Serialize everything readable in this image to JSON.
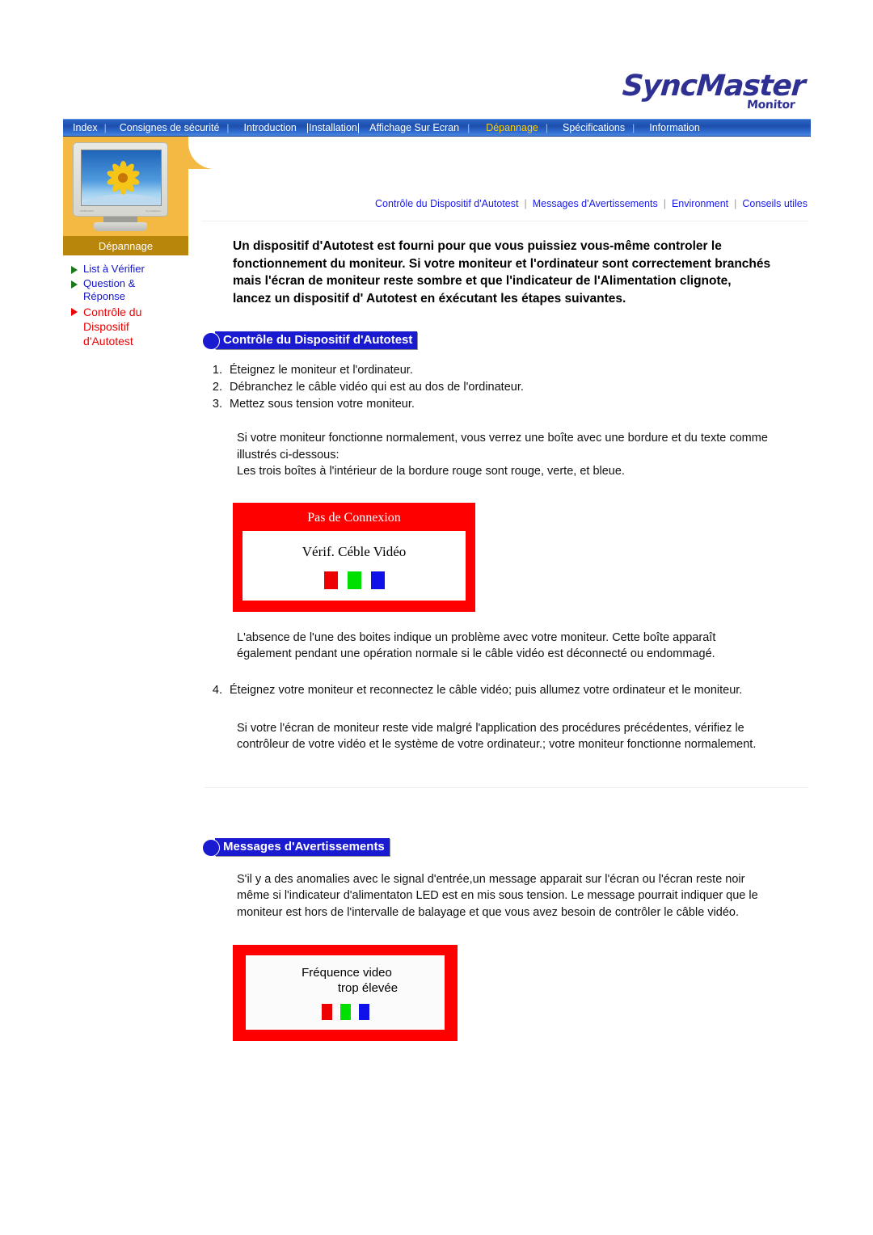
{
  "logo": {
    "main": "SyncMaster",
    "sub": "Monitor"
  },
  "nav": {
    "items": [
      {
        "label": "Index",
        "active": false
      },
      {
        "label": "Consignes de sécurité",
        "active": false
      },
      {
        "label": "Introduction",
        "active": false
      },
      {
        "label": "|Installation|",
        "active": false
      },
      {
        "label": "Affichage Sur Ecran",
        "active": false
      },
      {
        "label": "Dépannage",
        "active": true
      },
      {
        "label": "Spécifications",
        "active": false
      },
      {
        "label": "Information",
        "active": false
      }
    ],
    "separator": "|",
    "active_color": "#ffcc00",
    "bar_color": "#1e4fae"
  },
  "sidebar": {
    "title": "Dépannage",
    "thumbnail_icon": "monitor-flower-icon",
    "accent_color": "#f4b942",
    "title_bar_color": "#b8860b",
    "items": [
      {
        "label": "List à Vérifier",
        "active": false,
        "bullet": "triangle-right-icon"
      },
      {
        "label": "Question & Réponse",
        "active": false,
        "bullet": "triangle-right-icon"
      },
      {
        "label": "Contrôle du Dispositif d'Autotest",
        "active": true,
        "bullet": "triangle-right-icon"
      }
    ],
    "link_color": "#1414cc",
    "active_link_color": "#ee0000"
  },
  "sublinks": {
    "items": [
      "Contrôle du Dispositif d'Autotest",
      "Messages d'Avertissements",
      "Environment",
      "Conseils utiles"
    ],
    "separator": "|",
    "color": "#1a1aee"
  },
  "intro": "Un dispositif d'Autotest est fourni pour que vous puissiez vous-même controler le fonctionnement du moniteur. Si votre moniteur et l'ordinateur sont correctement branchés mais l'écran de moniteur reste sombre et que l'indicateur de l'Alimentation clignote, lancez un dispositif d' Autotest en éxécutant les étapes suivantes.",
  "section1": {
    "heading": "Contrôle du Dispositif d'Autotest",
    "steps": [
      {
        "num": "1.",
        "text": "Éteignez le moniteur et l'ordinateur."
      },
      {
        "num": "2.",
        "text": "Débranchez le câble vidéo qui est au dos de l'ordinateur."
      },
      {
        "num": "3.",
        "text": "Mettez sous tension votre moniteur."
      }
    ],
    "para1": "Si votre moniteur fonctionne normalement, vous verrez une boîte avec une bordure et du texte comme illustrés ci-dessous:\nLes trois boîtes à l'intérieur de la bordure rouge sont rouge, verte, et bleue.",
    "errorbox": {
      "title": "Pas de Connexion",
      "message": "Vérif. Céble Vidéo",
      "border_color": "#ff0000",
      "swatches": [
        "#ee0000",
        "#00e000",
        "#1010e8"
      ]
    },
    "para2": "L'absence de l'une des boites indique un problème avec votre moniteur. Cette boîte apparaît également pendant une opération normale si le câble vidéo est déconnecté ou endommagé.",
    "step4": {
      "num": "4.",
      "text": "Éteignez votre moniteur et reconnectez le câble vidéo; puis allumez votre ordinateur et le moniteur."
    },
    "para3": "Si votre l'écran de moniteur reste vide malgré l'application des procédures précédentes, vérifiez le contrôleur de votre vidéo et le système de votre ordinateur.; votre moniteur fonctionne normalement."
  },
  "section2": {
    "heading": "Messages d'Avertissements",
    "para1": "S'il y a des anomalies avec le signal d'entrée,un message apparait sur l'écran ou l'écran reste noir même si l'indicateur d'alimentaton LED est en mis sous tension. Le message pourrait indiquer que le moniteur est hors de l'intervalle de balayage et que vous avez besoin de contrôler le câble vidéo.",
    "errorbox": {
      "line1": "Fréquence video",
      "line2": "trop élevée",
      "border_color": "#ff0000",
      "swatches": [
        "#ee0000",
        "#00e000",
        "#1010e8"
      ]
    }
  }
}
